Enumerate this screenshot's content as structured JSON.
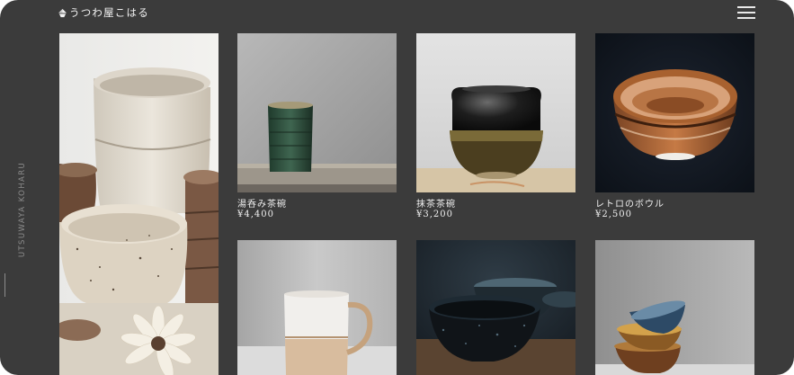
{
  "header": {
    "logo_text": "うつわ屋こはる",
    "vertical_text": "UTSUWAYA KOHARU"
  },
  "products": [
    {
      "name": "湯呑み茶碗",
      "price": "¥4,400"
    },
    {
      "name": "抹茶茶碗",
      "price": "¥3,200"
    },
    {
      "name": "レトロのボウル",
      "price": "¥2,500"
    }
  ],
  "colors": {
    "background": "#3b3b3b",
    "text": "#efefef"
  },
  "icons": {
    "logo": "logo-mark-icon",
    "menu": "hamburger-menu-icon"
  }
}
